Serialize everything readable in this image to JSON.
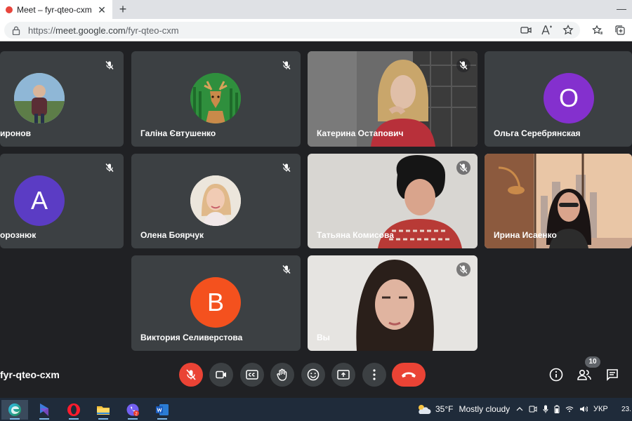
{
  "browser": {
    "tab_title": "Meet – fyr-qteo-cxm",
    "tab_close": "✕",
    "new_tab": "+",
    "minimize": "—",
    "url_prefix": "https://",
    "url_host": "meet.google.com",
    "url_path": "/fyr-qteo-cxm"
  },
  "participants": [
    {
      "name": "иронов",
      "type": "photo"
    },
    {
      "name": "Галіна Євтушенко",
      "type": "deer"
    },
    {
      "name": "Катерина Остапович",
      "type": "video"
    },
    {
      "name": "Ольга Серебрянская",
      "type": "letter",
      "letter": "О",
      "color": "#8430ce"
    },
    {
      "name": "орознюк",
      "type": "letter",
      "letter": "А",
      "color": "#5b3cc4"
    },
    {
      "name": "Олена Боярчук",
      "type": "photo"
    },
    {
      "name": "Татьяна Комисова",
      "type": "video"
    },
    {
      "name": "Ирина Исаенко",
      "type": "video"
    },
    {
      "name": "Виктория Селиверстова",
      "type": "letter",
      "letter": "В",
      "color": "#f4511e"
    },
    {
      "name": "Вы",
      "type": "video"
    }
  ],
  "meeting": {
    "code": "fyr-qteo-cxm",
    "participant_count": "10"
  },
  "taskbar": {
    "temperature": "35°F",
    "weather": "Mostly cloudy",
    "language": "УКР",
    "time": "23.",
    "viber_badge": "2"
  },
  "colors": {
    "accent": "#8ab4f8",
    "danger": "#ea4335",
    "tile": "#3c4043",
    "background": "#202124"
  }
}
